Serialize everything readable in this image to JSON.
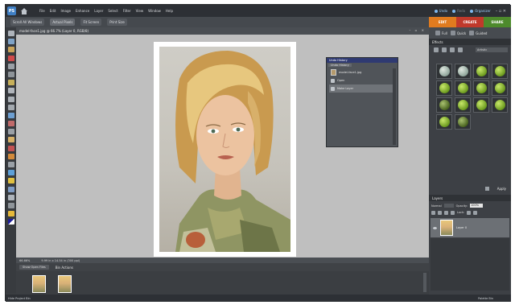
{
  "app": {
    "logo_text": "PS",
    "menu": [
      "File",
      "Edit",
      "Image",
      "Enhance",
      "Layer",
      "Select",
      "Filter",
      "View",
      "Window",
      "Help"
    ],
    "right_links": {
      "undo": "Undo",
      "redo": "Redo",
      "organizer": "Organizer"
    },
    "window_controls": "– ▫ ✕"
  },
  "doc_tabs": [
    "Scroll All Windows",
    "Actual Pixels",
    "Fit Screen",
    "Print Size"
  ],
  "modes": {
    "edit": "EDIT",
    "create": "CREATE",
    "share": "SHARE"
  },
  "document": {
    "title": "model-face1.jpg @ 66.7% (Layer 0, RGB/8)",
    "controls": "– ▫ ✕",
    "status_zoom": "66.66%",
    "status_info": "9.99 in x 14.54 in (300 ppi)"
  },
  "undo_history": {
    "title": "Undo History",
    "tab": "Undo History",
    "rows": [
      {
        "label": "model-face1.jpg",
        "selected": false
      },
      {
        "label": "Open",
        "selected": false
      },
      {
        "label": "Make Layer",
        "selected": true
      }
    ]
  },
  "project_bin": {
    "select_label": "Show Open Files",
    "actions_label": "Bin Actions",
    "thumbs": 2
  },
  "footer": {
    "left": "Hide Project Bin",
    "right": "Palette Bin"
  },
  "palette": {
    "modes": [
      "Full",
      "Quick",
      "Guided"
    ],
    "effects_title": "Effects",
    "effects_filter": "Artistic",
    "effects": [
      "Effect 1",
      "Effect 2",
      "Effect 3",
      "Effect 4",
      "Effect 5",
      "Effect 6",
      "Effect 7",
      "Effect 8",
      "Effect 9",
      "Effect 10",
      "Effect 11",
      "Effect 12",
      "Effect 13",
      "Effect 14"
    ],
    "apply_label": "Apply",
    "layers_title": "Layers",
    "blend_mode": "Normal",
    "opacity_label": "Opacity:",
    "opacity_value": "100%",
    "lock_label": "Lock:",
    "layer_name": "Layer 0"
  },
  "colors": {
    "accent_edit": "#e07b1f",
    "accent_create": "#c0392b",
    "accent_share": "#4d8a2c",
    "app_bg": "#3a3d41",
    "canvas_bg": "#bfbfbf"
  }
}
